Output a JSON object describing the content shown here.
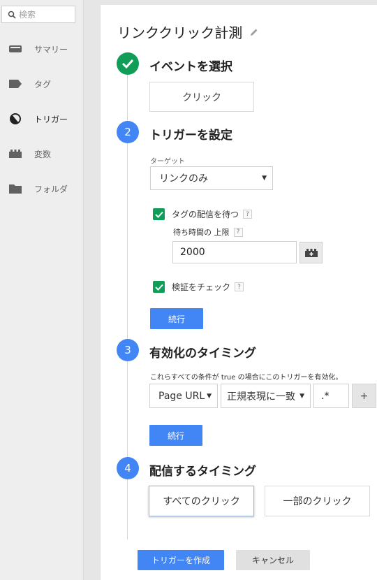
{
  "sidebar": {
    "search_placeholder": "検索",
    "items": [
      {
        "label": "サマリー",
        "icon": "summary-icon"
      },
      {
        "label": "タグ",
        "icon": "tag-icon"
      },
      {
        "label": "トリガー",
        "icon": "trigger-icon"
      },
      {
        "label": "変数",
        "icon": "variable-icon"
      },
      {
        "label": "フォルダ",
        "icon": "folder-icon"
      }
    ]
  },
  "trigger": {
    "title": "リンククリック計測",
    "steps": [
      {
        "number": "",
        "title": "イベントを選択"
      },
      {
        "number": "2",
        "title": "トリガーを設定"
      },
      {
        "number": "3",
        "title": "有効化のタイミング"
      },
      {
        "number": "4",
        "title": "配信するタイミング"
      }
    ],
    "event": {
      "selected": "クリック"
    },
    "config": {
      "target_label": "ターゲット",
      "target_value": "リンクのみ",
      "wait_for_tags_label": "タグの配信を待つ",
      "wait_limit_label": "待ち時間の 上限",
      "wait_limit_value": "2000",
      "validation_label": "検証をチェック",
      "continue_label": "続行"
    },
    "enable": {
      "description": "これらすべての条件が true の場合にこのトリガーを有効化。",
      "variable": "Page URL",
      "operator": "正規表現に一致",
      "value": ".*",
      "add_label": "+",
      "continue_label": "続行"
    },
    "fire": {
      "options": [
        "すべてのクリック",
        "一部のクリック"
      ]
    },
    "help_mark": "?",
    "create_label": "トリガーを作成",
    "cancel_label": "キャンセル"
  },
  "colors": {
    "accent": "#4285f4",
    "done": "#0f9d58",
    "sidebar_bg": "#eeeeee"
  }
}
